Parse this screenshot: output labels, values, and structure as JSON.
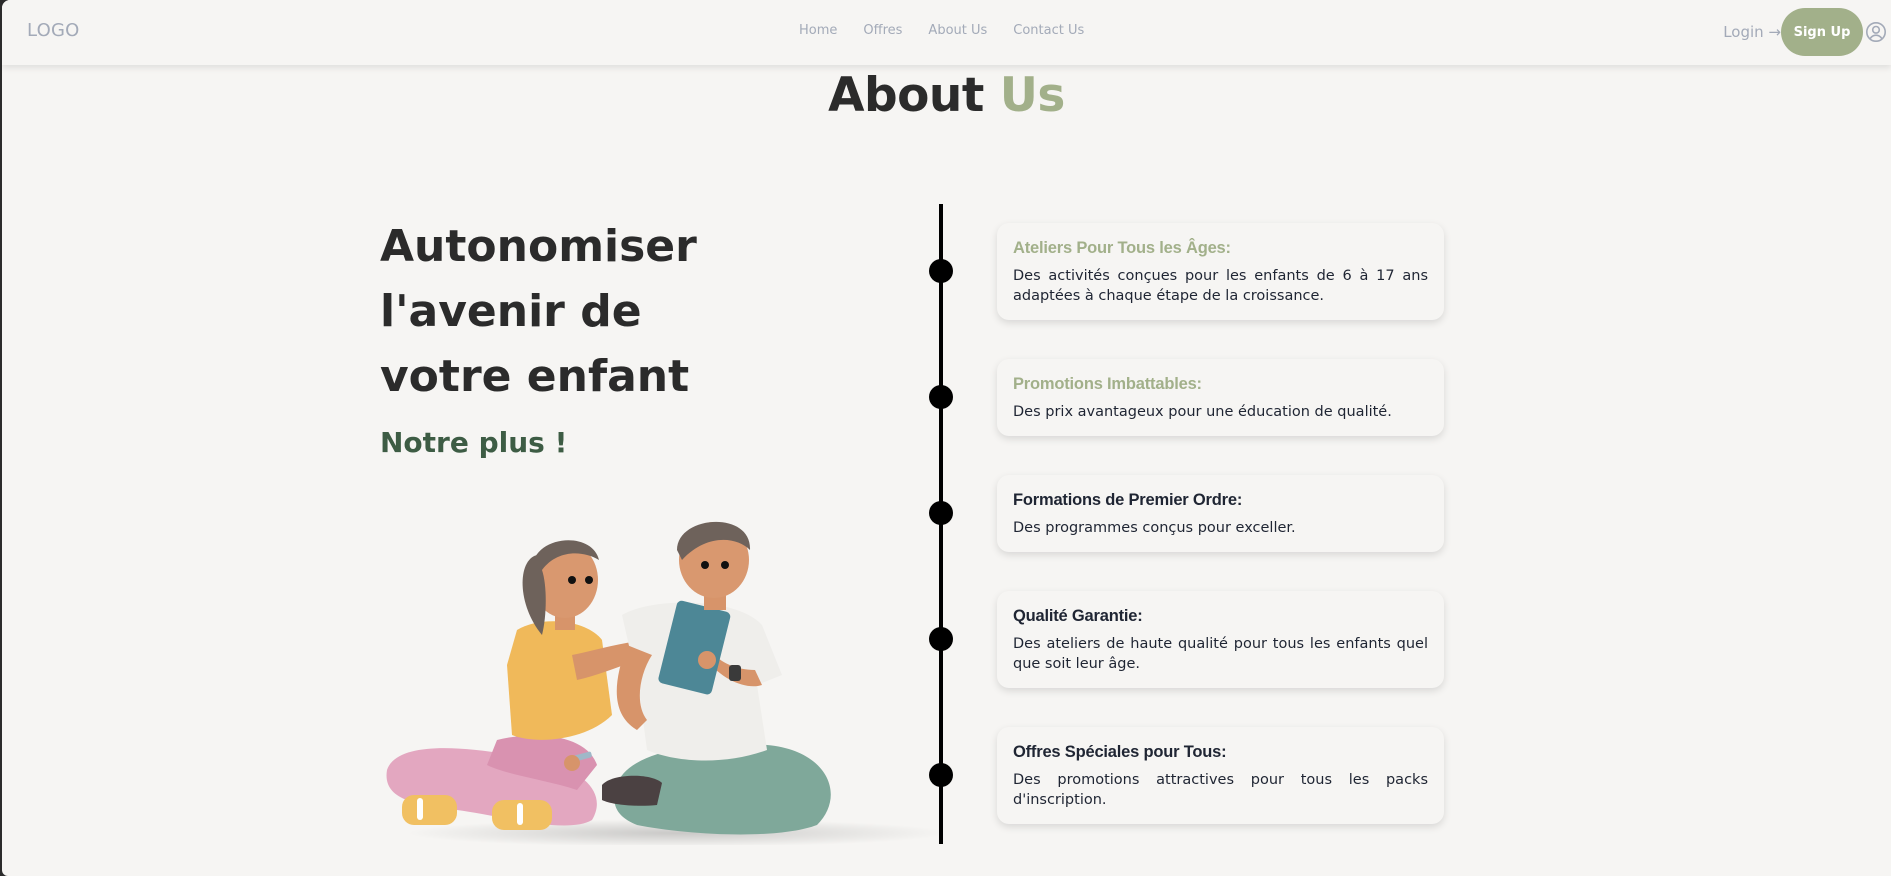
{
  "navbar": {
    "logo": "LOGO",
    "links": [
      {
        "label": "Home"
      },
      {
        "label": "Offres"
      },
      {
        "label": "About Us"
      },
      {
        "label": "Contact Us"
      }
    ],
    "login_label": "Login →",
    "signup_label": "Sign Up",
    "user_icon": "user-circle-icon"
  },
  "section": {
    "title_main": "About",
    "title_accent": "Us"
  },
  "hero": {
    "headline_lines": [
      "Autonomiser",
      "l'avenir de",
      "votre enfant"
    ],
    "subheadline": "Notre plus !",
    "illustration": "two-kids-with-tablet-illustration"
  },
  "colors": {
    "accent": "#a2b08a",
    "dark_green": "#3d5c44",
    "text_dark": "#2b2b2b",
    "nav_text": "#a3aab8",
    "background": "#f6f5f3"
  },
  "timeline": {
    "items": [
      {
        "title": "Ateliers Pour Tous les Âges:",
        "text": "Des activités conçues pour les enfants de 6 à 17 ans adaptées à chaque étape de la croissance.",
        "highlighted": true
      },
      {
        "title": "Promotions Imbattables:",
        "text": "Des prix avantageux pour une éducation de qualité.",
        "highlighted": true
      },
      {
        "title": "Formations de Premier Ordre:",
        "text": "Des programmes conçus pour exceller.",
        "highlighted": false
      },
      {
        "title": "Qualité Garantie:",
        "text": "Des ateliers de haute qualité pour tous les enfants quel que soit leur âge.",
        "highlighted": false
      },
      {
        "title": "Offres Spéciales pour Tous:",
        "text": "Des promotions attractives pour tous les packs d'inscription.",
        "highlighted": false
      }
    ]
  }
}
